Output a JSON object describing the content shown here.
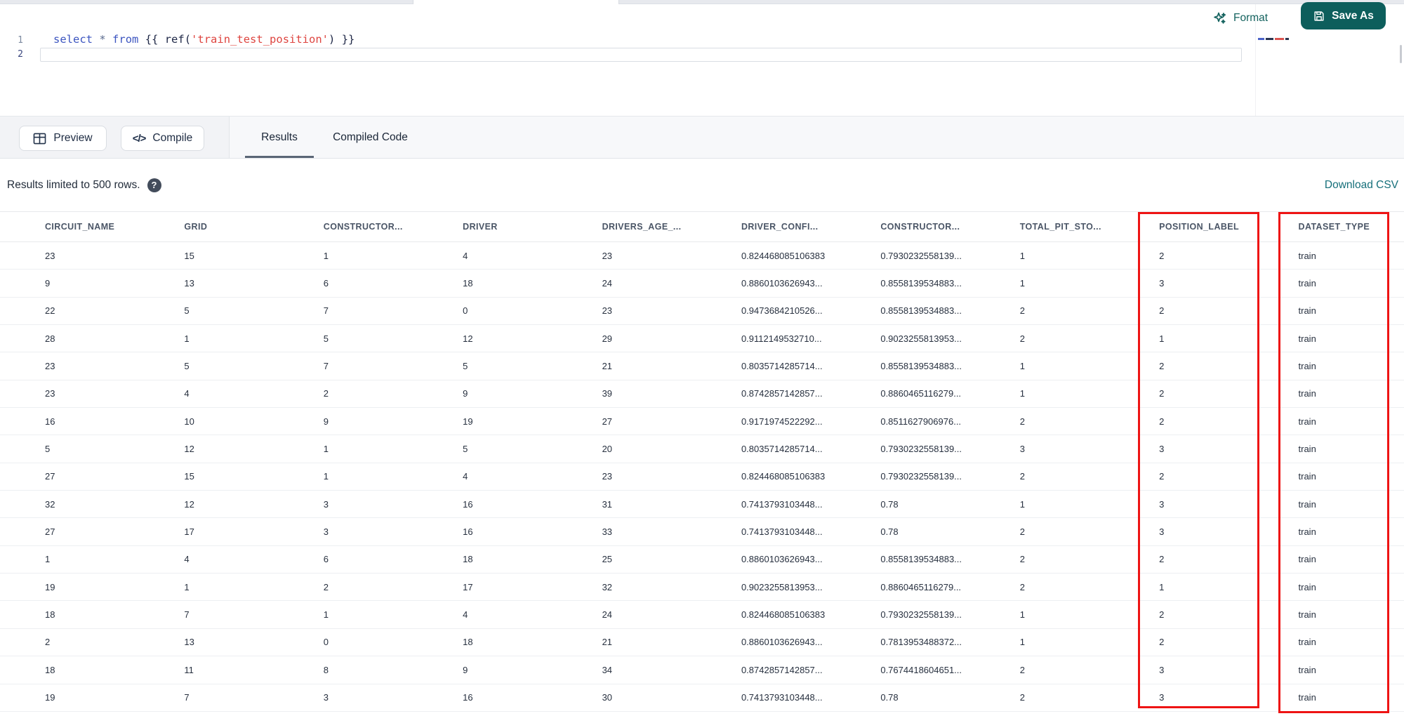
{
  "editor": {
    "line1_number": "1",
    "line2_number": "2",
    "code": {
      "kw_select": "select",
      "op_star": "*",
      "kw_from": "from",
      "jinja_open": "{{",
      "fn_ref": "ref(",
      "str_model": "'train_test_position'",
      "fn_close": ")",
      "jinja_close": "}}"
    }
  },
  "toolbar": {
    "format_label": "Format",
    "save_as_label": "Save As"
  },
  "action_bar": {
    "preview_label": "Preview",
    "compile_label": "Compile",
    "compile_glyph": "</>",
    "tabs": [
      {
        "label": "Results",
        "active": true
      },
      {
        "label": "Compiled Code",
        "active": false
      }
    ]
  },
  "results_bar": {
    "limit_text": "Results limited to 500 rows.",
    "help_glyph": "?",
    "download_label": "Download CSV"
  },
  "table": {
    "columns": [
      "CIRCUIT_NAME",
      "GRID",
      "CONSTRUCTOR...",
      "DRIVER",
      "DRIVERS_AGE_...",
      "DRIVER_CONFI...",
      "CONSTRUCTOR...",
      "TOTAL_PIT_STO...",
      "POSITION_LABEL",
      "DATASET_TYPE"
    ],
    "rows": [
      [
        "23",
        "15",
        "1",
        "4",
        "23",
        "0.824468085106383",
        "0.7930232558139...",
        "1",
        "2",
        "train"
      ],
      [
        "9",
        "13",
        "6",
        "18",
        "24",
        "0.8860103626943...",
        "0.8558139534883...",
        "1",
        "3",
        "train"
      ],
      [
        "22",
        "5",
        "7",
        "0",
        "23",
        "0.9473684210526...",
        "0.8558139534883...",
        "2",
        "2",
        "train"
      ],
      [
        "28",
        "1",
        "5",
        "12",
        "29",
        "0.9112149532710...",
        "0.9023255813953...",
        "2",
        "1",
        "train"
      ],
      [
        "23",
        "5",
        "7",
        "5",
        "21",
        "0.8035714285714...",
        "0.8558139534883...",
        "1",
        "2",
        "train"
      ],
      [
        "23",
        "4",
        "2",
        "9",
        "39",
        "0.8742857142857...",
        "0.8860465116279...",
        "1",
        "2",
        "train"
      ],
      [
        "16",
        "10",
        "9",
        "19",
        "27",
        "0.9171974522292...",
        "0.8511627906976...",
        "2",
        "2",
        "train"
      ],
      [
        "5",
        "12",
        "1",
        "5",
        "20",
        "0.8035714285714...",
        "0.7930232558139...",
        "3",
        "3",
        "train"
      ],
      [
        "27",
        "15",
        "1",
        "4",
        "23",
        "0.824468085106383",
        "0.7930232558139...",
        "2",
        "2",
        "train"
      ],
      [
        "32",
        "12",
        "3",
        "16",
        "31",
        "0.7413793103448...",
        "0.78",
        "1",
        "3",
        "train"
      ],
      [
        "27",
        "17",
        "3",
        "16",
        "33",
        "0.7413793103448...",
        "0.78",
        "2",
        "3",
        "train"
      ],
      [
        "1",
        "4",
        "6",
        "18",
        "25",
        "0.8860103626943...",
        "0.8558139534883...",
        "2",
        "2",
        "train"
      ],
      [
        "19",
        "1",
        "2",
        "17",
        "32",
        "0.9023255813953...",
        "0.8860465116279...",
        "2",
        "1",
        "train"
      ],
      [
        "18",
        "7",
        "1",
        "4",
        "24",
        "0.824468085106383",
        "0.7930232558139...",
        "1",
        "2",
        "train"
      ],
      [
        "2",
        "13",
        "0",
        "18",
        "21",
        "0.8860103626943...",
        "0.7813953488372...",
        "1",
        "2",
        "train"
      ],
      [
        "18",
        "11",
        "8",
        "9",
        "34",
        "0.8742857142857...",
        "0.7674418604651...",
        "2",
        "3",
        "train"
      ],
      [
        "19",
        "7",
        "3",
        "16",
        "30",
        "0.7413793103448...",
        "0.78",
        "2",
        "3",
        "train"
      ]
    ]
  },
  "annotations": {
    "highlight_color": "#ee1414",
    "highlighted_columns": [
      "POSITION_LABEL",
      "DATASET_TYPE"
    ]
  },
  "colors": {
    "accent_teal": "#0d5e5c",
    "link_teal": "#156f7a",
    "keyword_blue": "#3c55c0",
    "string_red": "#de4540"
  }
}
